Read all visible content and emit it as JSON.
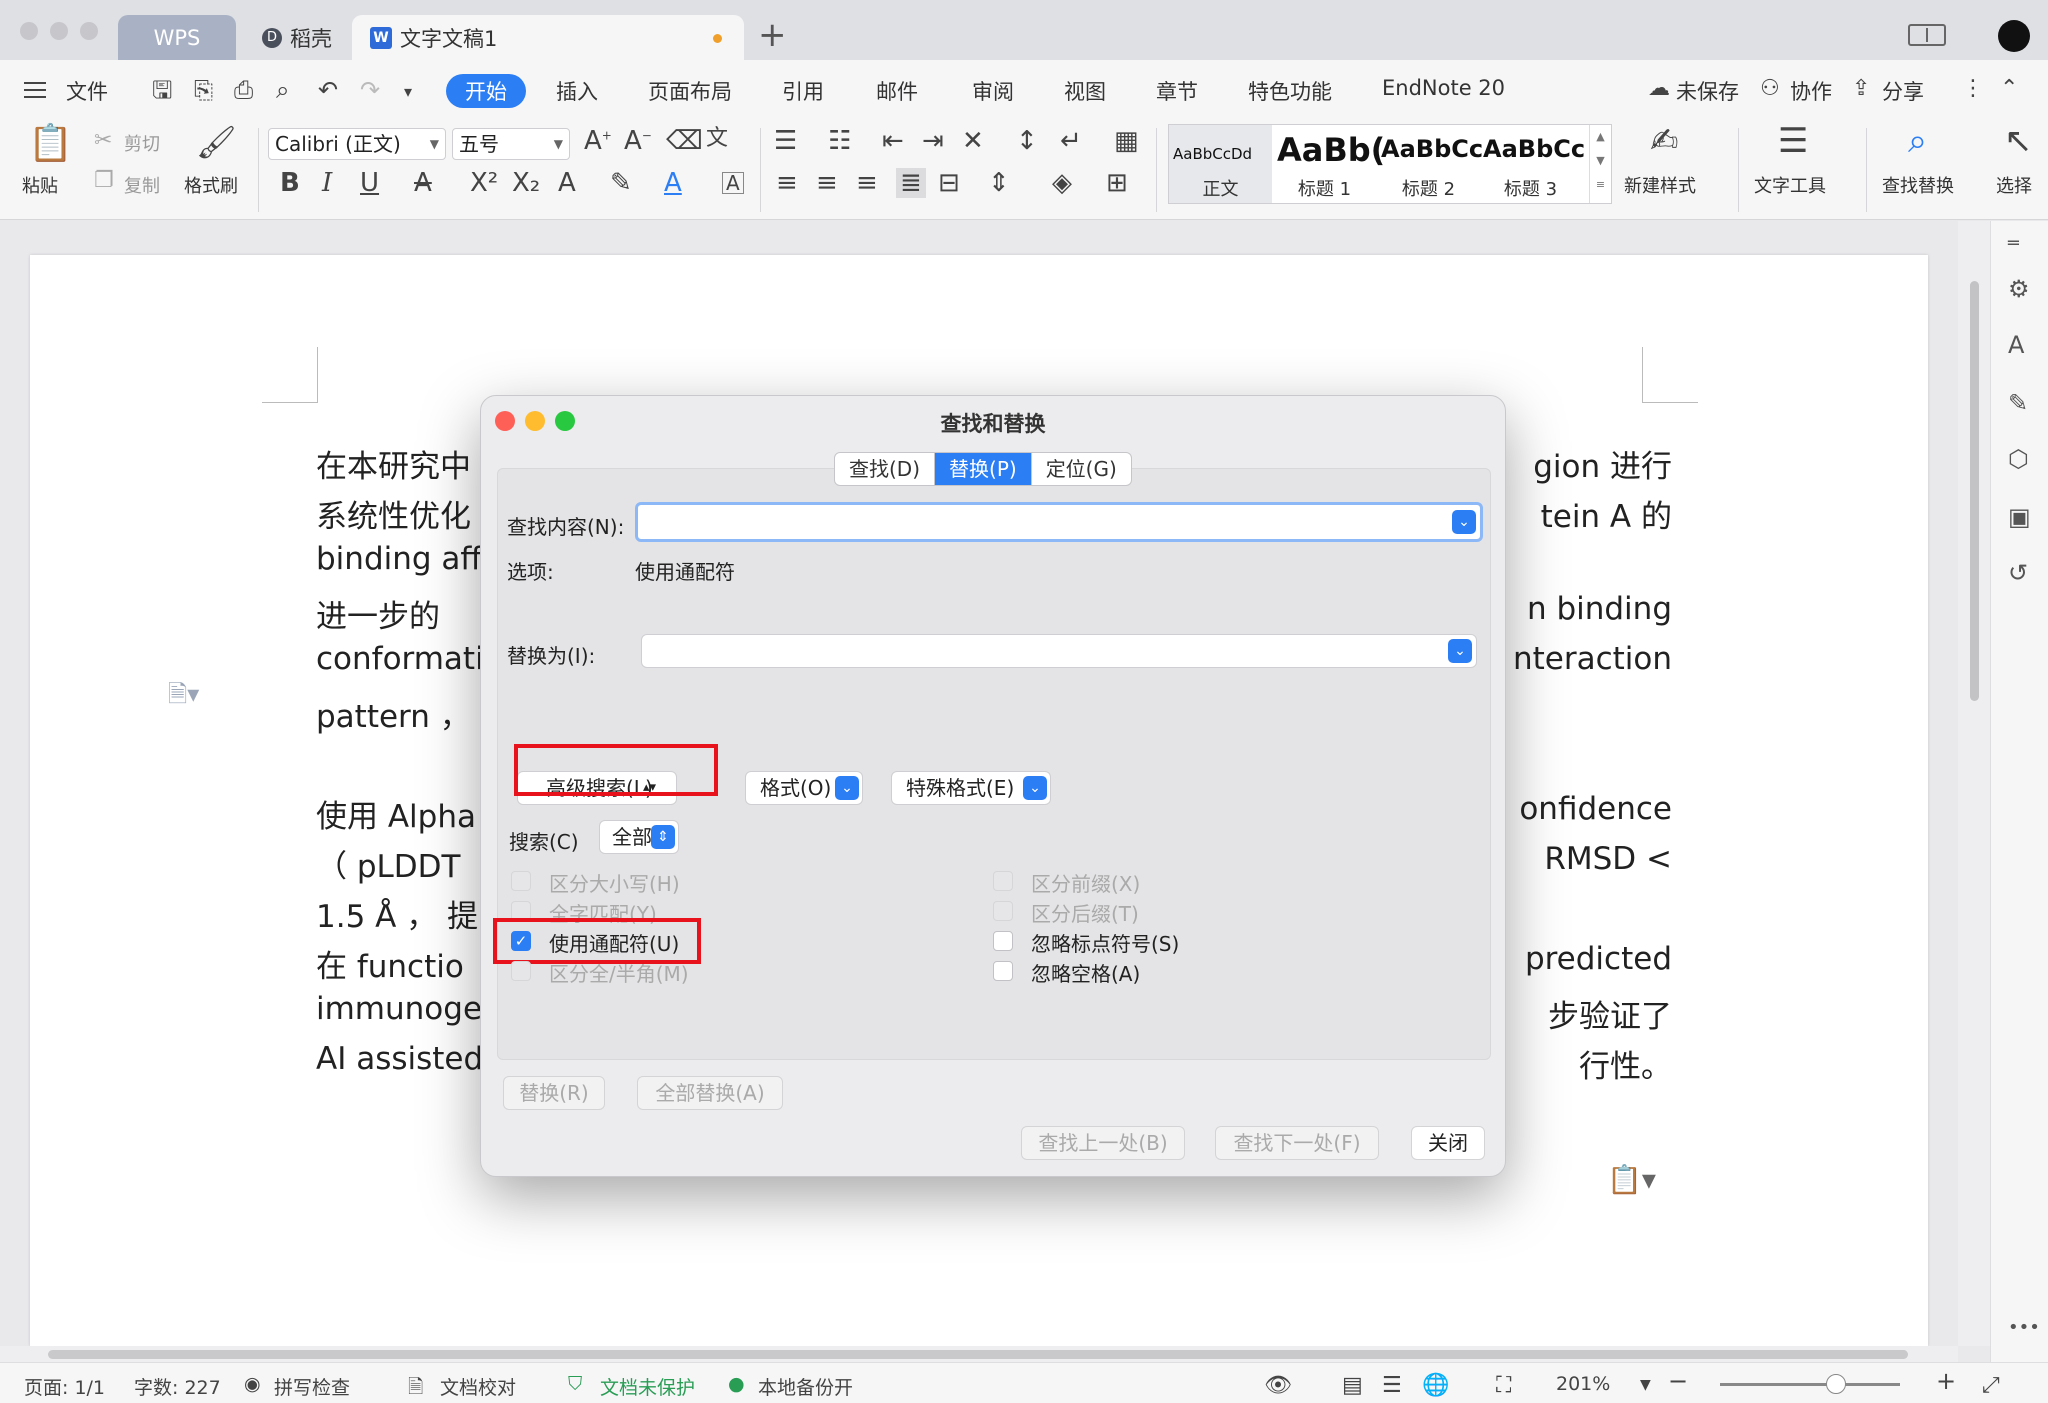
{
  "tabs": {
    "wps": "WPS",
    "daoke": "稻壳",
    "doc": "文字文稿1"
  },
  "menu": {
    "file": "文件",
    "items": [
      "开始",
      "插入",
      "页面布局",
      "引用",
      "邮件",
      "审阅",
      "视图",
      "章节",
      "特色功能",
      "EndNote 20"
    ],
    "unsaved": "未保存",
    "collab": "协作",
    "share": "分享"
  },
  "ribbon": {
    "paste": "粘贴",
    "cut": "剪切",
    "copy": "复制",
    "format_painter": "格式刷",
    "font_name": "Calibri (正文)",
    "font_size": "五号",
    "styles": [
      {
        "sample": "AaBbCcDd",
        "name": "正文"
      },
      {
        "sample": "AaBb(",
        "name": "标题 1"
      },
      {
        "sample": "AaBbCc",
        "name": "标题 2"
      },
      {
        "sample": "AaBbCc",
        "name": "标题 3"
      }
    ],
    "new_style": "新建样式",
    "text_tools": "文字工具",
    "find_replace": "查找替换",
    "select": "选择"
  },
  "document": {
    "lines": [
      {
        "left": "在本研究中",
        "right": "gion 进行"
      },
      {
        "left": "系统性优化",
        "right": "tein A 的"
      },
      {
        "left": "binding affi",
        "right": ""
      },
      {
        "left": "进一步的",
        "right": "n binding"
      },
      {
        "left": "conformatio",
        "right": "nteraction"
      },
      {
        "left": "pattern ，",
        "right": ""
      },
      {
        "left": "使用 Alpha",
        "right": "onfidence"
      },
      {
        "left": "（ pLDDT",
        "right": "RMSD <"
      },
      {
        "left": "1.5 Å ， 提",
        "right": ""
      },
      {
        "left": "在   functio",
        "right": "predicted"
      },
      {
        "left": "immunogen",
        "right": "步验证了"
      },
      {
        "left": "AI assisted",
        "right": "行性。"
      }
    ]
  },
  "dialog": {
    "title": "查找和替换",
    "tabs": [
      "查找(D)",
      "替换(P)",
      "定位(G)"
    ],
    "find_label": "查找内容(N):",
    "find_value": "",
    "options_label": "选项:",
    "options_value": "使用通配符",
    "replace_label": "替换为(I):",
    "replace_value": "",
    "advanced_button": "高级搜索(L)",
    "format_button": "格式(O)",
    "special_button": "特殊格式(E)",
    "search_label": "搜索(C)",
    "search_value": "全部",
    "checkboxes_left": [
      {
        "label": "区分大小写(H)",
        "checked": false,
        "enabled": false
      },
      {
        "label": "全字匹配(Y)",
        "checked": false,
        "enabled": false
      },
      {
        "label": "使用通配符(U)",
        "checked": true,
        "enabled": true
      },
      {
        "label": "区分全/半角(M)",
        "checked": false,
        "enabled": false
      }
    ],
    "checkboxes_right": [
      {
        "label": "区分前缀(X)",
        "checked": false,
        "enabled": false
      },
      {
        "label": "区分后缀(T)",
        "checked": false,
        "enabled": false
      },
      {
        "label": "忽略标点符号(S)",
        "checked": false,
        "enabled": true
      },
      {
        "label": "忽略空格(A)",
        "checked": false,
        "enabled": true
      }
    ],
    "replace_button": "替换(R)",
    "replace_all_button": "全部替换(A)",
    "find_prev_button": "查找上一处(B)",
    "find_next_button": "查找下一处(F)",
    "close_button": "关闭"
  },
  "status": {
    "page": "页面: 1/1",
    "words": "字数: 227",
    "spell": "拼写检查",
    "proof": "文档校对",
    "protect": "文档未保护",
    "backup": "本地备份开",
    "zoom": "201%"
  },
  "colors": {
    "accent": "#2c7ef4",
    "highlight": "#e8121d",
    "green": "#2a9d55"
  }
}
